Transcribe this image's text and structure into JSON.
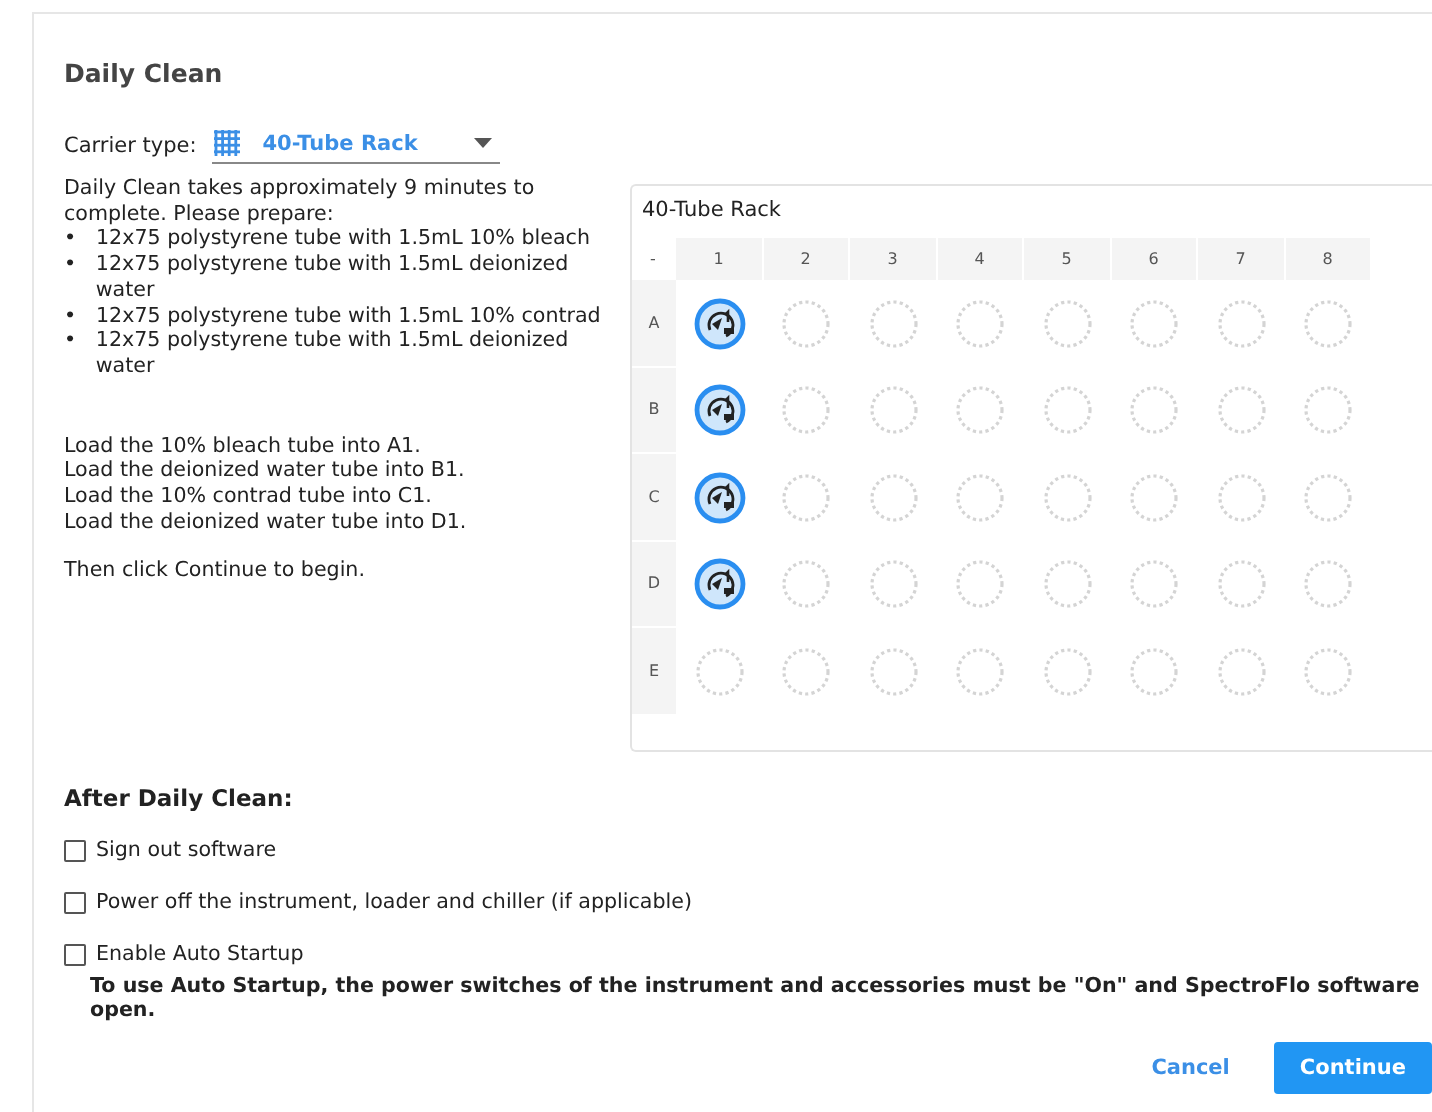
{
  "dialog": {
    "title": "Daily Clean",
    "carrier": {
      "label": "Carrier type:",
      "value": "40-Tube Rack"
    },
    "instructions": {
      "intro": "Daily Clean takes approximately 9 minutes to complete. Please prepare:",
      "items": [
        {
          "bullet": "•",
          "text": "12x75 polystyrene tube with 1.5mL 10% bleach"
        },
        {
          "bullet": "•",
          "text": "12x75 polystyrene tube with 1.5mL deionized water"
        },
        {
          "bullet": "•",
          "text": "12x75 polystyrene tube with 1.5mL 10% contrad"
        },
        {
          "bullet": "•",
          "text": "12x75 polystyrene tube with 1.5mL deionized water"
        }
      ],
      "load_steps": [
        "Load the 10% bleach tube into A1.",
        "Load the deionized water tube into B1.",
        "Load the 10% contrad tube into C1.",
        "Load the deionized water tube into D1."
      ],
      "closing": "Then click Continue to begin."
    },
    "rack": {
      "title": "40-Tube Rack",
      "corner": "-",
      "columns": [
        "1",
        "2",
        "3",
        "4",
        "5",
        "6",
        "7",
        "8"
      ],
      "rows": [
        {
          "label": "A",
          "cells": [
            {
              "filled": true
            },
            {
              "filled": false
            },
            {
              "filled": false
            },
            {
              "filled": false
            },
            {
              "filled": false
            },
            {
              "filled": false
            },
            {
              "filled": false
            },
            {
              "filled": false
            }
          ]
        },
        {
          "label": "B",
          "cells": [
            {
              "filled": true
            },
            {
              "filled": false
            },
            {
              "filled": false
            },
            {
              "filled": false
            },
            {
              "filled": false
            },
            {
              "filled": false
            },
            {
              "filled": false
            },
            {
              "filled": false
            }
          ]
        },
        {
          "label": "C",
          "cells": [
            {
              "filled": true
            },
            {
              "filled": false
            },
            {
              "filled": false
            },
            {
              "filled": false
            },
            {
              "filled": false
            },
            {
              "filled": false
            },
            {
              "filled": false
            },
            {
              "filled": false
            }
          ]
        },
        {
          "label": "D",
          "cells": [
            {
              "filled": true
            },
            {
              "filled": false
            },
            {
              "filled": false
            },
            {
              "filled": false
            },
            {
              "filled": false
            },
            {
              "filled": false
            },
            {
              "filled": false
            },
            {
              "filled": false
            }
          ]
        },
        {
          "label": "E",
          "cells": [
            {
              "filled": false
            },
            {
              "filled": false
            },
            {
              "filled": false
            },
            {
              "filled": false
            },
            {
              "filled": false
            },
            {
              "filled": false
            },
            {
              "filled": false
            },
            {
              "filled": false
            }
          ]
        }
      ]
    },
    "after": {
      "title": "After Daily Clean:",
      "options": [
        {
          "label": "Sign out software",
          "checked": false
        },
        {
          "label": "Power off the instrument, loader and chiller (if applicable)",
          "checked": false
        },
        {
          "label": "Enable Auto Startup",
          "checked": false
        }
      ],
      "note": "To use Auto Startup, the power switches of the instrument and accessories must be \"On\" and SpectroFlo software open."
    },
    "buttons": [
      {
        "label": "Cancel",
        "kind": "link"
      },
      {
        "label": "Continue",
        "kind": "primary"
      }
    ]
  }
}
